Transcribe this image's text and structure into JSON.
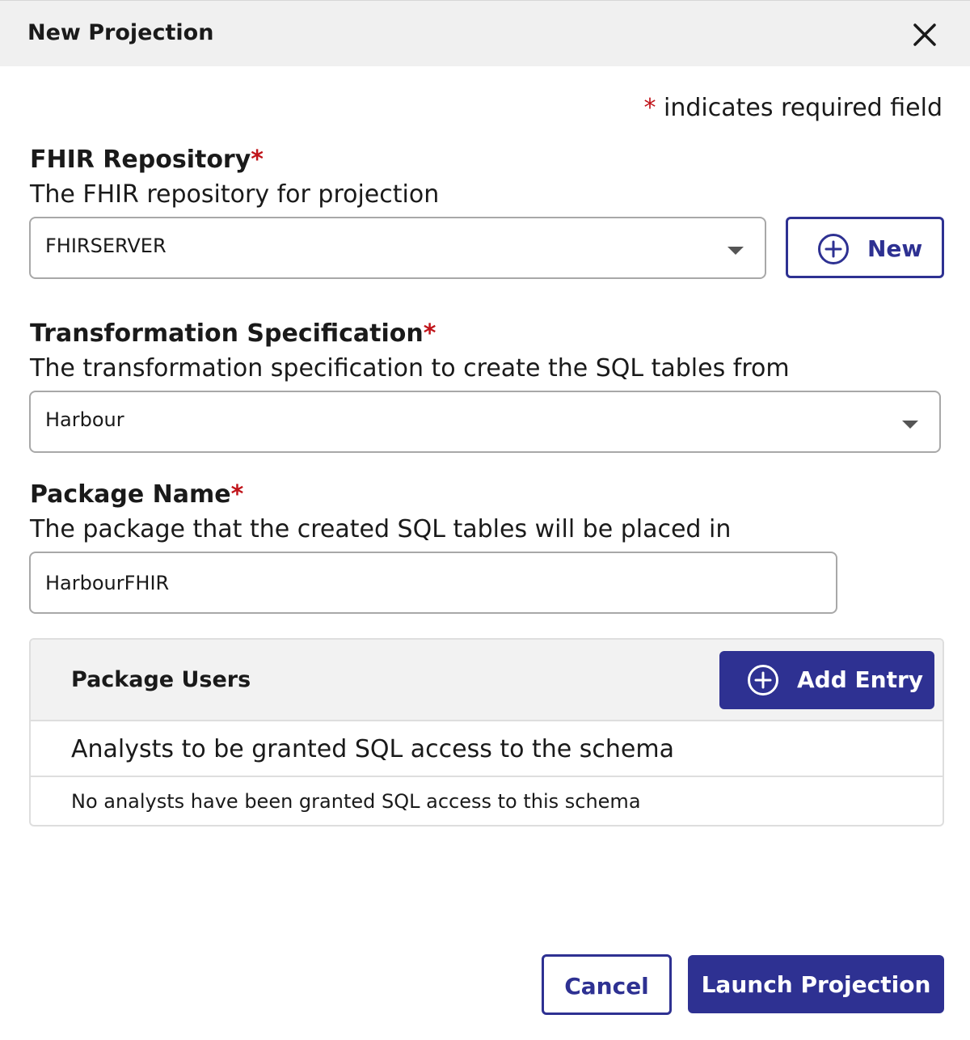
{
  "dialog": {
    "title": "New Projection",
    "close_icon": "close-icon"
  },
  "required_note": {
    "star": "*",
    "text": " indicates required field"
  },
  "fhir_repository": {
    "label": "FHIR Repository",
    "required_star": "*",
    "help": "The FHIR repository for projection",
    "selected_value": "FHIRSERVER",
    "new_button_label": "New",
    "new_button_icon": "plus-circle-icon"
  },
  "transformation_spec": {
    "label": "Transformation Specification",
    "required_star": "*",
    "help": "The transformation specification to create the SQL tables from",
    "selected_value": "Harbour"
  },
  "package_name": {
    "label": "Package Name",
    "required_star": "*",
    "help": "The package that the created SQL tables will be placed in",
    "value": "HarbourFHIR"
  },
  "package_users": {
    "title": "Package Users",
    "add_button_label": "Add Entry",
    "add_button_icon": "plus-circle-icon",
    "description": "Analysts to be granted SQL access to the schema",
    "empty_message": "No analysts have been granted SQL access to this schema"
  },
  "footer": {
    "cancel_label": "Cancel",
    "launch_label": "Launch Projection"
  },
  "colors": {
    "accent": "#2e3192",
    "required": "#c0141a",
    "header_bg": "#f0f0f0"
  }
}
